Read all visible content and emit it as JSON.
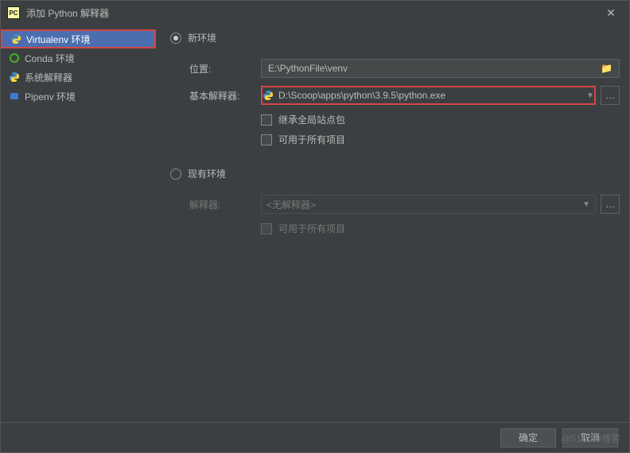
{
  "titlebar": {
    "icon_text": "PC",
    "title": "添加 Python 解释器"
  },
  "sidebar": {
    "items": [
      {
        "label": "Virtualenv 环境"
      },
      {
        "label": "Conda 环境"
      },
      {
        "label": "系统解释器"
      },
      {
        "label": "Pipenv 环境"
      }
    ]
  },
  "main": {
    "new_env_label": "新环境",
    "existing_env_label": "现有环境",
    "location_label": "位置:",
    "location_value": "E:\\PythonFile\\venv",
    "base_interpreter_label": "基本解释器:",
    "base_interpreter_value": "D:\\Scoop\\apps\\python\\3.9.5\\python.exe",
    "inherit_label": "继承全局站点包",
    "available_all_label": "可用于所有项目",
    "interpreter_label": "解释器:",
    "interpreter_value": "<无解释器>",
    "available_all_label2": "可用于所有项目"
  },
  "footer": {
    "ok": "确定",
    "cancel": "取消"
  },
  "watermark": "@51CTO博客"
}
